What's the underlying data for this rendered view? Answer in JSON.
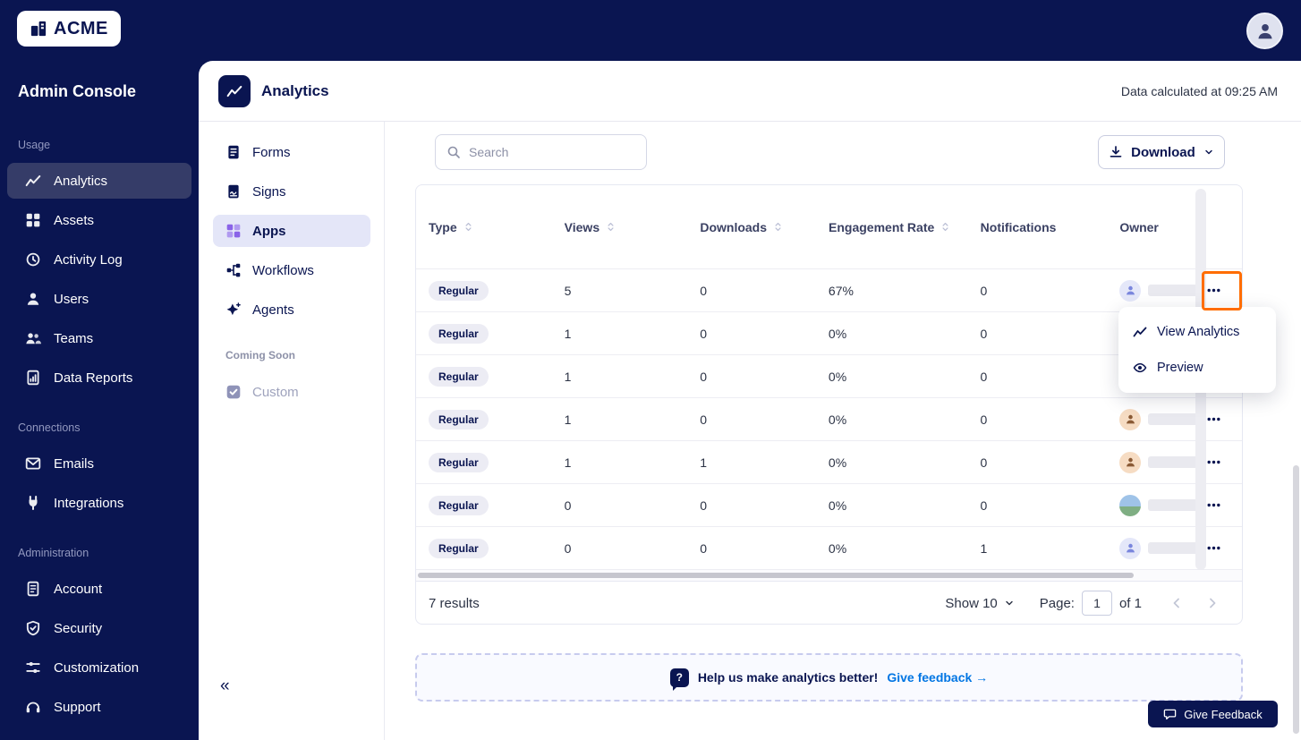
{
  "topbar": {
    "logo_text": "ACME"
  },
  "sidebar": {
    "title": "Admin Console",
    "sections": [
      {
        "label": "Usage",
        "items": [
          {
            "label": "Analytics",
            "icon": "chart-line",
            "active": true
          },
          {
            "label": "Assets",
            "icon": "grid"
          },
          {
            "label": "Activity Log",
            "icon": "clock"
          },
          {
            "label": "Users",
            "icon": "user"
          },
          {
            "label": "Teams",
            "icon": "users"
          },
          {
            "label": "Data Reports",
            "icon": "report"
          }
        ]
      },
      {
        "label": "Connections",
        "items": [
          {
            "label": "Emails",
            "icon": "envelope"
          },
          {
            "label": "Integrations",
            "icon": "plug"
          }
        ]
      },
      {
        "label": "Administration",
        "items": [
          {
            "label": "Account",
            "icon": "document"
          },
          {
            "label": "Security",
            "icon": "shield"
          },
          {
            "label": "Customization",
            "icon": "sliders"
          },
          {
            "label": "Support",
            "icon": "headset"
          }
        ]
      }
    ]
  },
  "header": {
    "title": "Analytics",
    "status": "Data calculated at 09:25 AM"
  },
  "subnav": {
    "items": [
      {
        "label": "Forms",
        "icon": "doc-lines"
      },
      {
        "label": "Signs",
        "icon": "doc-signature"
      },
      {
        "label": "Apps",
        "icon": "apps-grid",
        "active": true
      },
      {
        "label": "Workflows",
        "icon": "flow"
      },
      {
        "label": "Agents",
        "icon": "sparkle"
      }
    ],
    "coming_soon": "Coming Soon",
    "custom_label": "Custom",
    "collapse": "«"
  },
  "toolbar": {
    "search_placeholder": "Search",
    "download_label": "Download"
  },
  "table": {
    "columns": [
      {
        "label": "Type",
        "sortable": true
      },
      {
        "label": "Views",
        "sortable": true
      },
      {
        "label": "Downloads",
        "sortable": true
      },
      {
        "label": "Engagement Rate",
        "sortable": true
      },
      {
        "label": "Notifications",
        "sortable": false
      },
      {
        "label": "Owner",
        "sortable": false
      }
    ],
    "rows": [
      {
        "type": "Regular",
        "views": "5",
        "downloads": "0",
        "engagement": "67%",
        "notifications": "0"
      },
      {
        "type": "Regular",
        "views": "1",
        "downloads": "0",
        "engagement": "0%",
        "notifications": "0"
      },
      {
        "type": "Regular",
        "views": "1",
        "downloads": "0",
        "engagement": "0%",
        "notifications": "0"
      },
      {
        "type": "Regular",
        "views": "1",
        "downloads": "0",
        "engagement": "0%",
        "notifications": "0"
      },
      {
        "type": "Regular",
        "views": "1",
        "downloads": "1",
        "engagement": "0%",
        "notifications": "0"
      },
      {
        "type": "Regular",
        "views": "0",
        "downloads": "0",
        "engagement": "0%",
        "notifications": "0"
      },
      {
        "type": "Regular",
        "views": "0",
        "downloads": "0",
        "engagement": "0%",
        "notifications": "1"
      }
    ]
  },
  "menu": {
    "items": [
      {
        "label": "View Analytics",
        "icon": "chart-line"
      },
      {
        "label": "Preview",
        "icon": "eye"
      }
    ]
  },
  "pagination": {
    "results": "7 results",
    "show_label": "Show 10",
    "page_label": "Page:",
    "page_value": "1",
    "of_label": "of 1"
  },
  "banner": {
    "icon_glyph": "?",
    "text": "Help us make analytics better!",
    "link_label": "Give feedback →"
  },
  "feedback": {
    "label": "Give Feedback"
  },
  "colors": {
    "navy": "#0a1551",
    "highlight_orange": "#ff6d00",
    "link_blue": "#0075e3",
    "subnav_active_bg": "#e4e6f8"
  }
}
